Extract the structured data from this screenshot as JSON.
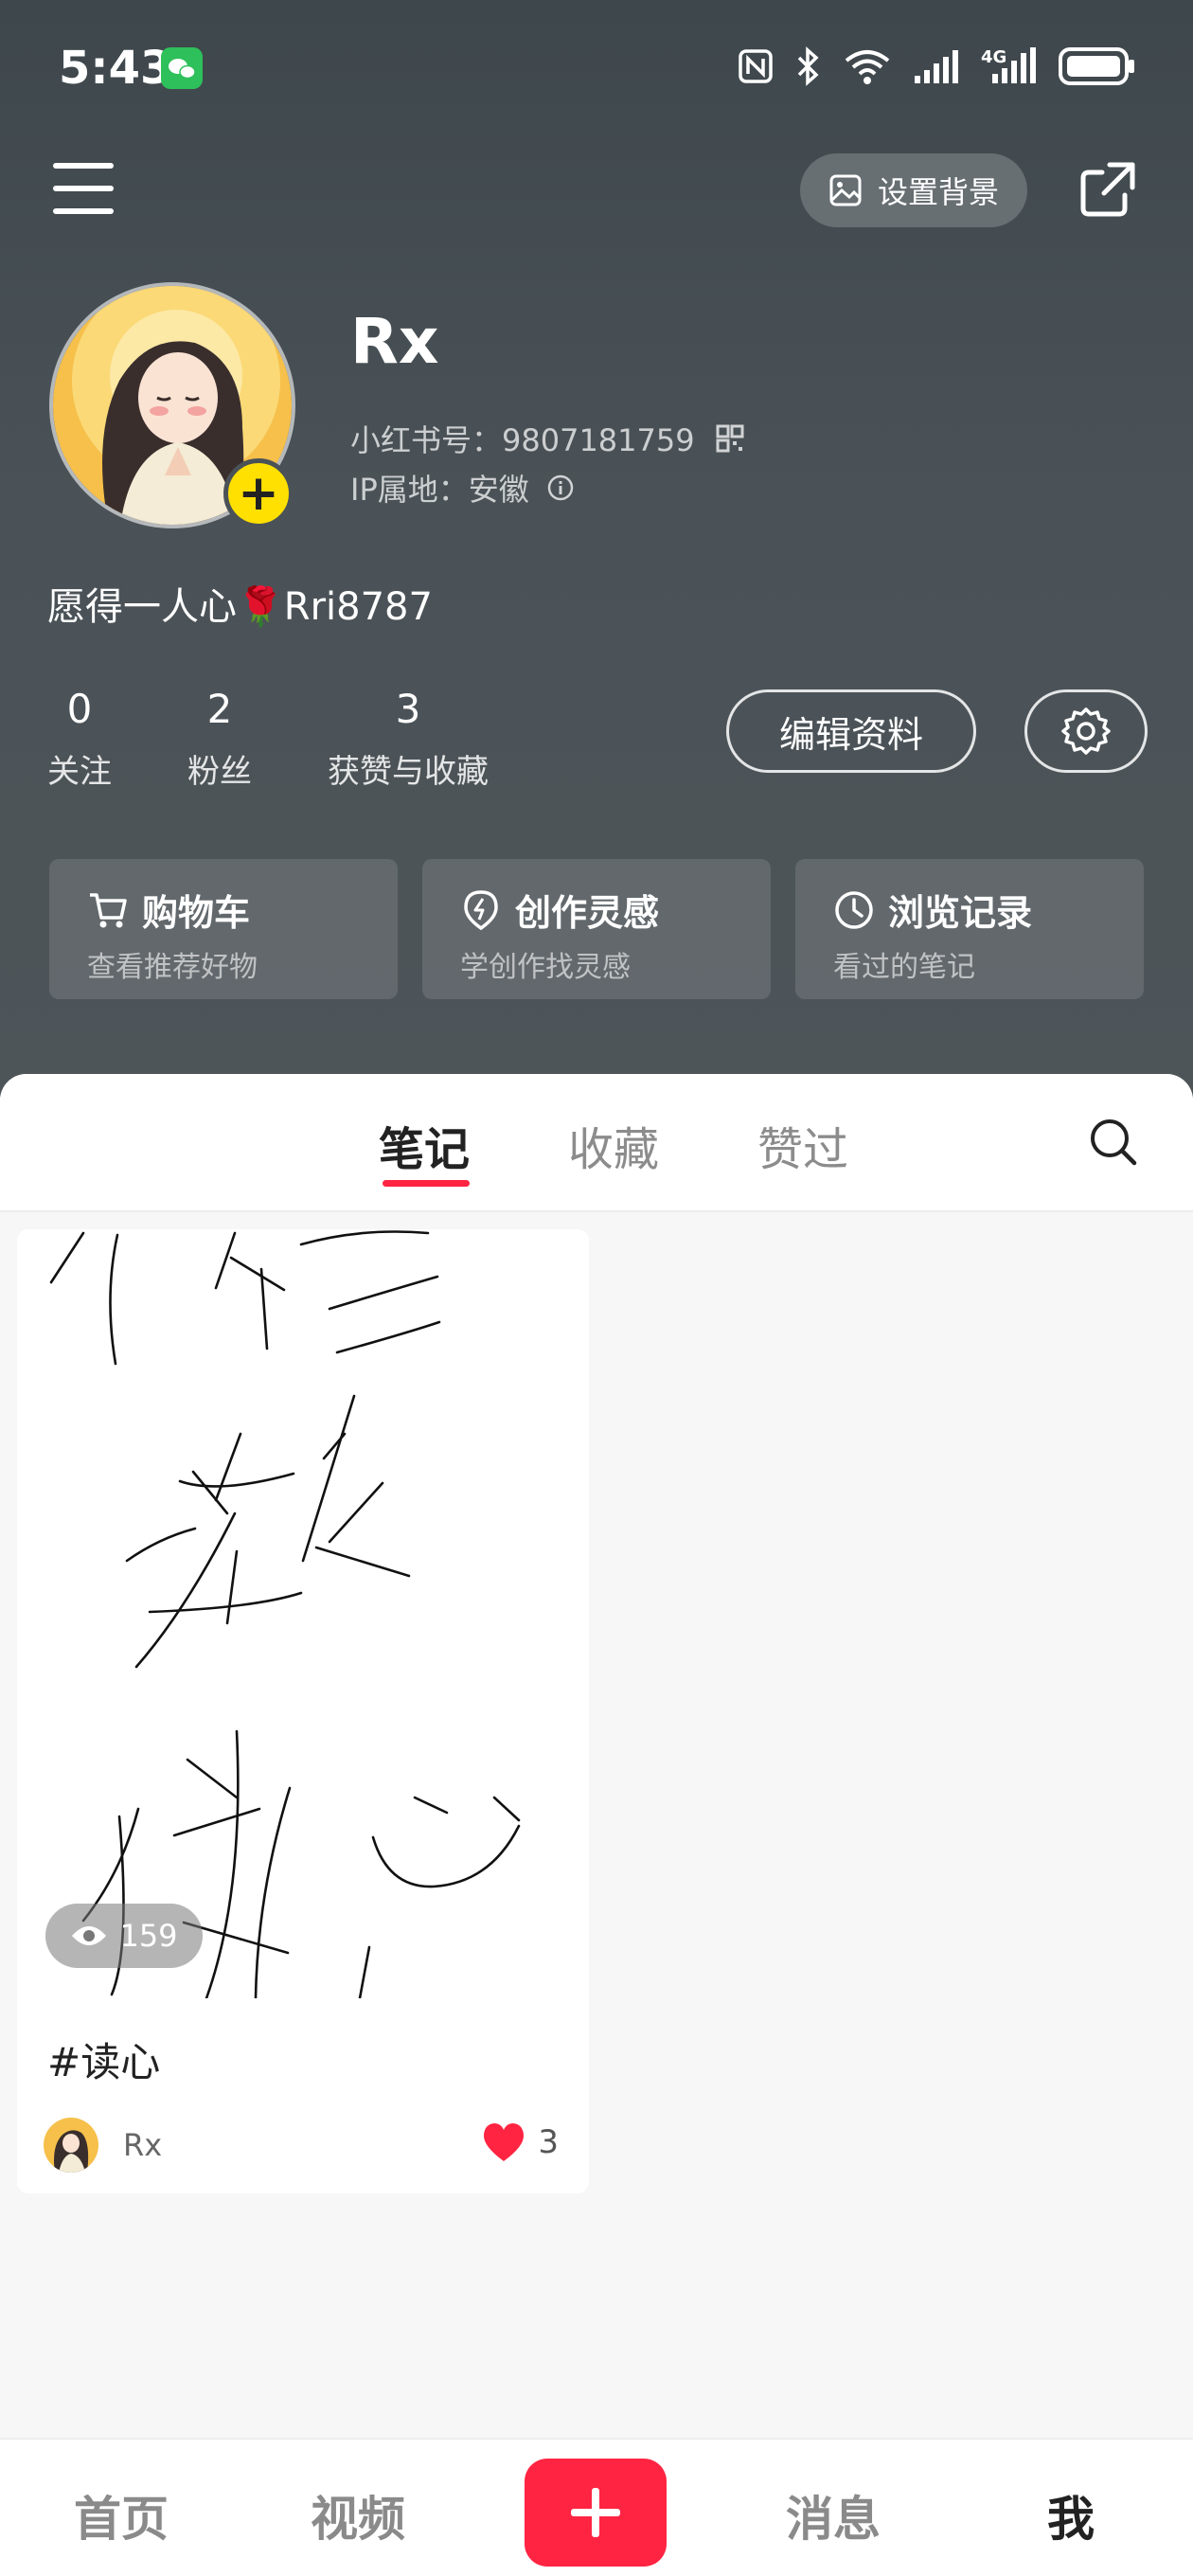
{
  "status_bar": {
    "time": "5:43"
  },
  "top_bar": {
    "set_background_label": "设置背景"
  },
  "profile": {
    "username": "Rx",
    "red_id": "小红书号：9807181759",
    "ip_location": "IP属地：安徽",
    "bio": "愿得一人心🌹Rri8787"
  },
  "stats": [
    {
      "value": "0",
      "label": "关注"
    },
    {
      "value": "2",
      "label": "粉丝"
    },
    {
      "value": "3",
      "label": "获赞与收藏"
    }
  ],
  "edit_profile_label": "编辑资料",
  "shortcut_cards": [
    {
      "title": "购物车",
      "subtitle": "查看推荐好物",
      "icon": "cart-icon"
    },
    {
      "title": "创作灵感",
      "subtitle": "学创作找灵感",
      "icon": "bulb-icon"
    },
    {
      "title": "浏览记录",
      "subtitle": "看过的笔记",
      "icon": "clock-icon"
    }
  ],
  "tabs": [
    {
      "label": "笔记",
      "active": true
    },
    {
      "label": "收藏",
      "active": false
    },
    {
      "label": "赞过",
      "active": false
    }
  ],
  "note": {
    "views": "159",
    "title": "#读心",
    "author": "Rx",
    "likes": "3"
  },
  "bottom_nav": [
    {
      "label": "首页"
    },
    {
      "label": "视频"
    },
    {
      "label": "消息"
    },
    {
      "label": "我"
    }
  ],
  "colors": {
    "accent": "#ff2442",
    "header_bg": "#4a5257",
    "avatar_plus": "#ffe000"
  }
}
